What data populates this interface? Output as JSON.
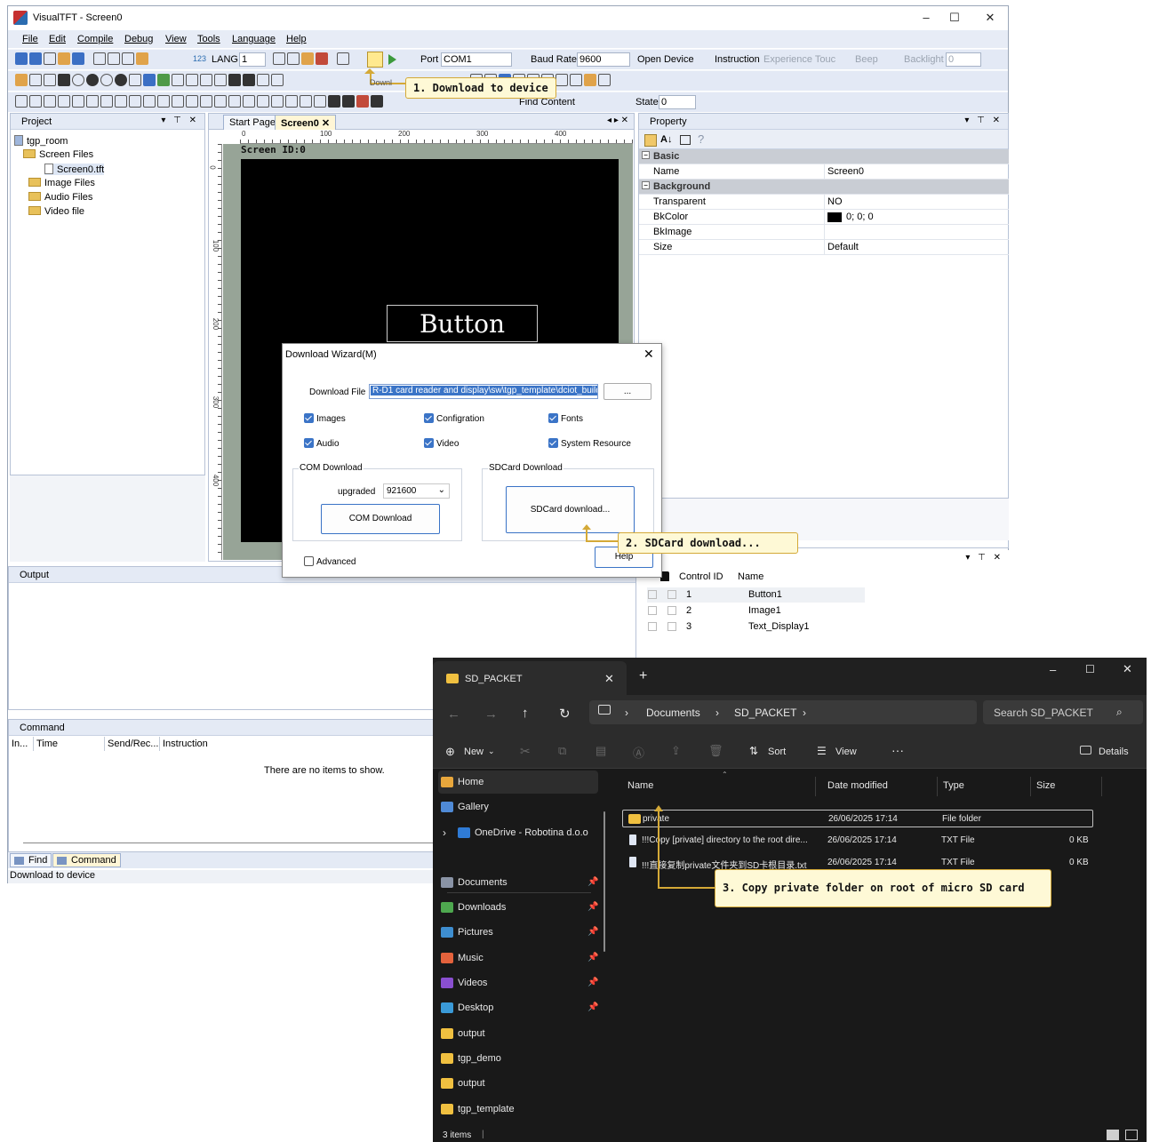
{
  "vtft": {
    "title": "VisualTFT - Screen0",
    "menu": [
      "File",
      "Edit",
      "Compile",
      "Debug",
      "View",
      "Tools",
      "Language",
      "Help"
    ],
    "toolbar": {
      "lang_label": "LANG",
      "lang_value": "1",
      "num_badge": "123",
      "port_label": "Port",
      "port_value": "COM1",
      "baud_label": "Baud Rate",
      "baud_value": "9600",
      "open_device": "Open Device",
      "instruction": "Instruction",
      "experience_touch": "Experience Touc",
      "beep": "Beep",
      "backlight_label": "Backlight",
      "backlight_value": "0",
      "state_label": "State",
      "state_value": "0",
      "find_content": "Find Content",
      "download_partial": "Downl"
    },
    "project": {
      "title": "Project",
      "tree": [
        "tgp_room",
        "Screen Files",
        "Screen0.tft",
        "Image Files",
        "Audio Files",
        "Video file"
      ]
    },
    "canvas": {
      "tabs": [
        "Start Page",
        "Screen0"
      ],
      "ruler_h": [
        "0",
        "100",
        "200",
        "300",
        "400"
      ],
      "ruler_v": [
        "0",
        "100",
        "200",
        "300",
        "400"
      ],
      "screen_id": "Screen ID:0",
      "button_text": "Button"
    },
    "property": {
      "title": "Property",
      "rows": [
        {
          "key": "Basic",
          "value": "",
          "cat": true
        },
        {
          "key": "Name",
          "value": "Screen0",
          "cat": false
        },
        {
          "key": "Background",
          "value": "",
          "cat": true
        },
        {
          "key": "Transparent",
          "value": "NO",
          "cat": false
        },
        {
          "key": "BkColor",
          "value": "0; 0; 0",
          "cat": false
        },
        {
          "key": "BkImage",
          "value": "",
          "cat": false
        },
        {
          "key": "Size",
          "value": "Default",
          "cat": false
        }
      ]
    },
    "controls": {
      "headers": [
        "Control ID",
        "Name"
      ],
      "rows": [
        {
          "id": "1",
          "name": "Button1"
        },
        {
          "id": "2",
          "name": "Image1"
        },
        {
          "id": "3",
          "name": "Text_Display1"
        }
      ]
    },
    "output": {
      "title": "Output"
    },
    "command": {
      "title": "Command",
      "headers": [
        "In...",
        "Time",
        "Send/Rec...",
        "Instruction"
      ],
      "empty": "There are no items to show."
    },
    "bottom_tabs": [
      "Find",
      "Command"
    ],
    "status": "Download to device"
  },
  "wizard": {
    "title": "Download Wizard(M)",
    "file_label": "Download File",
    "file_path": "R-D1 card reader and display\\sw\\tgp_template\\dciot_build\\",
    "browse": "...",
    "checks": [
      "Images",
      "Configration",
      "Fonts",
      "Audio",
      "Video",
      "System Resource"
    ],
    "com_group": "COM Download",
    "upgraded_label": "upgraded",
    "upgraded_value": "921600",
    "com_button": "COM Download",
    "sd_group": "SDCard Download",
    "sd_button": "SDCard download...",
    "advanced": "Advanced",
    "help": "Help"
  },
  "callouts": {
    "c1": "1. Download to device",
    "c2": "2. SDCard download...",
    "c3": "3. Copy private folder on root of micro SD card"
  },
  "explorer": {
    "tab_title": "SD_PACKET",
    "breadcrumb": [
      "Documents",
      "SD_PACKET"
    ],
    "search_placeholder": "Search SD_PACKET",
    "cmd": {
      "new": "New",
      "sort": "Sort",
      "view": "View",
      "details": "Details"
    },
    "nav": [
      {
        "label": "Home",
        "pin": false,
        "color": "#e8a73c"
      },
      {
        "label": "Gallery",
        "pin": false,
        "color": "#4f8ad6"
      },
      {
        "label": "OneDrive - Robotina d.o.o",
        "pin": false,
        "color": "#2f7bd6"
      },
      {
        "label": "Documents",
        "pin": true,
        "color": "#8a94a6"
      },
      {
        "label": "Downloads",
        "pin": true,
        "color": "#4ea84f"
      },
      {
        "label": "Pictures",
        "pin": true,
        "color": "#3e8ed0"
      },
      {
        "label": "Music",
        "pin": true,
        "color": "#e4623c"
      },
      {
        "label": "Videos",
        "pin": true,
        "color": "#8a4fd0"
      },
      {
        "label": "Desktop",
        "pin": true,
        "color": "#3a9ad8"
      },
      {
        "label": "output",
        "pin": false,
        "color": "#f0c040"
      },
      {
        "label": "tgp_demo",
        "pin": false,
        "color": "#f0c040"
      },
      {
        "label": "output",
        "pin": false,
        "color": "#f0c040"
      },
      {
        "label": "tgp_template",
        "pin": false,
        "color": "#f0c040"
      }
    ],
    "columns": [
      "Name",
      "Date modified",
      "Type",
      "Size"
    ],
    "files": [
      {
        "name": "private",
        "date": "26/06/2025 17:14",
        "type": "File folder",
        "size": ""
      },
      {
        "name": "!!!Copy [private] directory to the root dire...",
        "date": "26/06/2025 17:14",
        "type": "TXT File",
        "size": "0 KB"
      },
      {
        "name": "!!!直接复制private文件夹到SD卡根目录.txt",
        "date": "26/06/2025 17:14",
        "type": "TXT File",
        "size": "0 KB"
      }
    ],
    "status": "3 items"
  }
}
